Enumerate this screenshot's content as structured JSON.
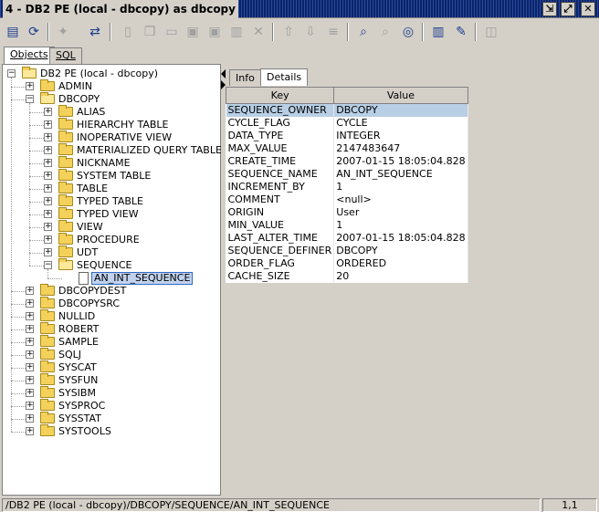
{
  "window": {
    "title": "4 - DB2 PE (local - dbcopy)  as dbcopy"
  },
  "toolbar": {
    "icons": [
      "properties-icon",
      "refresh-icon",
      "run-icon",
      "shuffle-icon",
      "new-icon",
      "copy-icon",
      "open-icon",
      "save-icon",
      "save-as-icon",
      "print-icon",
      "delete-icon",
      "up-icon",
      "down-icon",
      "list-icon",
      "find-icon",
      "find-db-icon",
      "connect-icon",
      "books-icon",
      "edit-book-icon",
      "layout-icon"
    ]
  },
  "outer_tabs": [
    "Objects",
    "SQL"
  ],
  "tree": {
    "root": "DB2 PE (local - dbcopy)",
    "items": [
      {
        "label": "ADMIN"
      },
      {
        "label": "DBCOPY",
        "children": [
          "ALIAS",
          "HIERARCHY TABLE",
          "INOPERATIVE VIEW",
          "MATERIALIZED QUERY TABLE",
          "NICKNAME",
          "SYSTEM TABLE",
          "TABLE",
          "TYPED TABLE",
          "TYPED VIEW",
          "VIEW",
          "PROCEDURE",
          "UDT"
        ],
        "sequence_label": "SEQUENCE",
        "sequence_child": "AN_INT_SEQUENCE"
      },
      {
        "label": "DBCOPYDEST"
      },
      {
        "label": "DBCOPYSRC"
      },
      {
        "label": "NULLID"
      },
      {
        "label": "ROBERT"
      },
      {
        "label": "SAMPLE"
      },
      {
        "label": "SQLJ"
      },
      {
        "label": "SYSCAT"
      },
      {
        "label": "SYSFUN"
      },
      {
        "label": "SYSIBM"
      },
      {
        "label": "SYSPROC"
      },
      {
        "label": "SYSSTAT"
      },
      {
        "label": "SYSTOOLS"
      }
    ]
  },
  "detail": {
    "tabs": [
      "Info",
      "Details"
    ],
    "columns": [
      "Key",
      "Value"
    ],
    "rows": [
      [
        "SEQUENCE_OWNER",
        "DBCOPY"
      ],
      [
        "CYCLE_FLAG",
        "CYCLE"
      ],
      [
        "DATA_TYPE",
        "INTEGER"
      ],
      [
        "MAX_VALUE",
        "2147483647"
      ],
      [
        "CREATE_TIME",
        "2007-01-15 18:05:04.828"
      ],
      [
        "SEQUENCE_NAME",
        "AN_INT_SEQUENCE"
      ],
      [
        "INCREMENT_BY",
        "1"
      ],
      [
        "COMMENT",
        "<null>"
      ],
      [
        "ORIGIN",
        "User"
      ],
      [
        "MIN_VALUE",
        "1"
      ],
      [
        "LAST_ALTER_TIME",
        "2007-01-15 18:05:04.828"
      ],
      [
        "SEQUENCE_DEFINER",
        "DBCOPY"
      ],
      [
        "ORDER_FLAG",
        "ORDERED"
      ],
      [
        "CACHE_SIZE",
        "20"
      ]
    ]
  },
  "status": {
    "path": "/DB2 PE (local - dbcopy)/DBCOPY/SEQUENCE/AN_INT_SEQUENCE",
    "position": "1,1"
  },
  "colors": {
    "title_bar": "#0a246a",
    "selection": "#c1d2ee",
    "selection_border": "#316ac5",
    "folder": "#f3d15a"
  }
}
